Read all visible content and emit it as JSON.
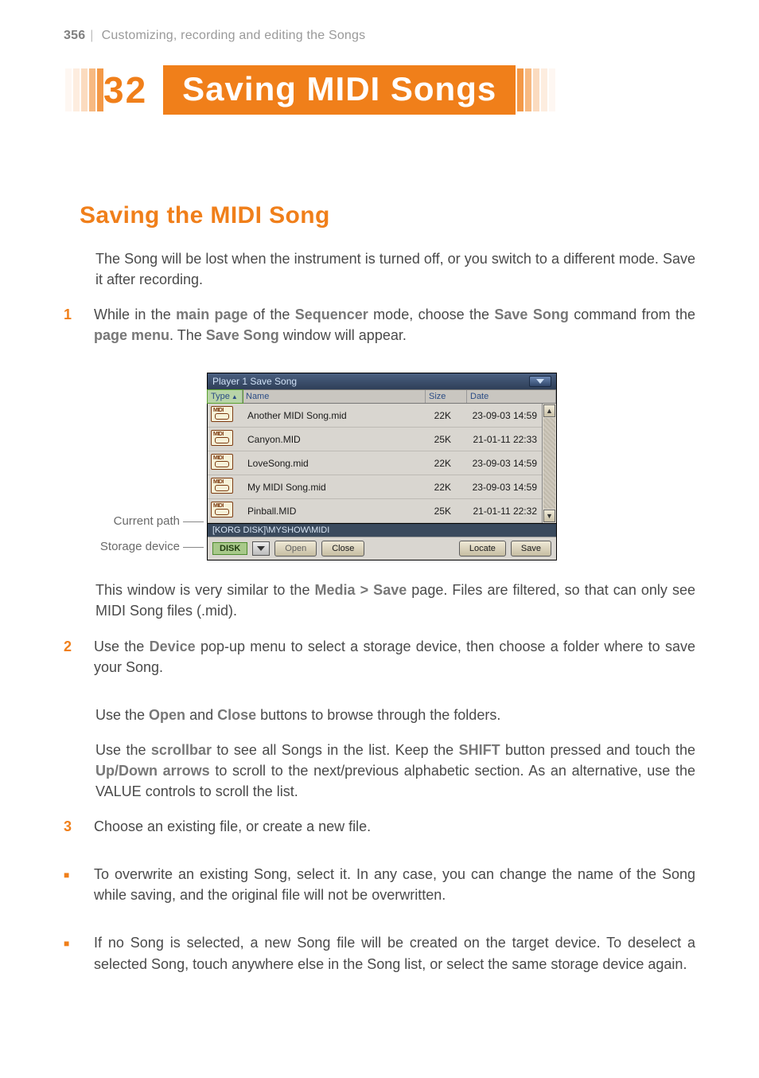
{
  "header": {
    "page_number": "356",
    "divider": "|",
    "running_title": "Customizing, recording and editing the Songs"
  },
  "chapter": {
    "number": "32",
    "title": "Saving MIDI Songs"
  },
  "section_title": "Saving the MIDI Song",
  "intro_para": "The Song will be lost when the instrument is turned off, or you switch to a different mode. Save it after recording.",
  "step1": {
    "num": "1",
    "pre1": "While in the ",
    "ui1": "main page",
    "mid1": " of the ",
    "ui2": "Sequencer",
    "mid2": " mode, choose the ",
    "ui3": "Save Song",
    "mid3": " command from the ",
    "ui4": "page menu",
    "mid4": ". The ",
    "ui5": "Save Song",
    "post": " window will appear."
  },
  "callouts": {
    "current_path": "Current path",
    "storage_device": "Storage device"
  },
  "screenshot": {
    "titlebar": "Player 1   Save Song",
    "headers": {
      "type": "Type",
      "name": "Name",
      "size": "Size",
      "date": "Date"
    },
    "rows": [
      {
        "name": "Another MIDI Song.mid",
        "size": "22K",
        "date": "23-09-03 14:59"
      },
      {
        "name": "Canyon.MID",
        "size": "25K",
        "date": "21-01-11 22:33"
      },
      {
        "name": "LoveSong.mid",
        "size": "22K",
        "date": "23-09-03 14:59"
      },
      {
        "name": "My MIDI Song.mid",
        "size": "22K",
        "date": "23-09-03 14:59"
      },
      {
        "name": "Pinball.MID",
        "size": "25K",
        "date": "21-01-11 22:32"
      }
    ],
    "path": "[KORG DISK]\\MYSHOW\\MIDI",
    "footer": {
      "device": "DISK",
      "open": "Open",
      "close": "Close",
      "locate": "Locate",
      "save": "Save"
    }
  },
  "after_shot": {
    "pre": "This window is very similar to the ",
    "ui": "Media > Save",
    "post": " page. Files are filtered, so that can only see MIDI Song files (.mid)."
  },
  "step2": {
    "num": "2",
    "pre": "Use the ",
    "ui": "Device",
    "post": " pop-up menu to select a storage device, then choose a folder where to save your Song."
  },
  "step2_p2": {
    "pre": "Use the ",
    "ui1": "Open",
    "mid": " and ",
    "ui2": "Close",
    "post": " buttons to browse through the folders."
  },
  "step2_p3": {
    "pre": "Use the ",
    "ui1": "scrollbar",
    "mid1": " to see all Songs in the list. Keep the ",
    "ui2": "SHIFT",
    "mid2": " button pressed and touch the ",
    "ui3": "Up/Down arrows",
    "post": " to scroll to the next/previous alphabetic section. As an alternative, use the VALUE controls to scroll the list."
  },
  "step3": {
    "num": "3",
    "text": "Choose an existing file, or create a new file."
  },
  "bullet1": "To overwrite an existing Song, select it. In any case, you can change the name of the Song while saving, and the original file will not be overwritten.",
  "bullet2": "If no Song is selected, a new Song file will be created on the target device. To deselect a selected Song, touch anywhere else in the Song list, or select the same storage device again.",
  "bullet_marker": "■"
}
